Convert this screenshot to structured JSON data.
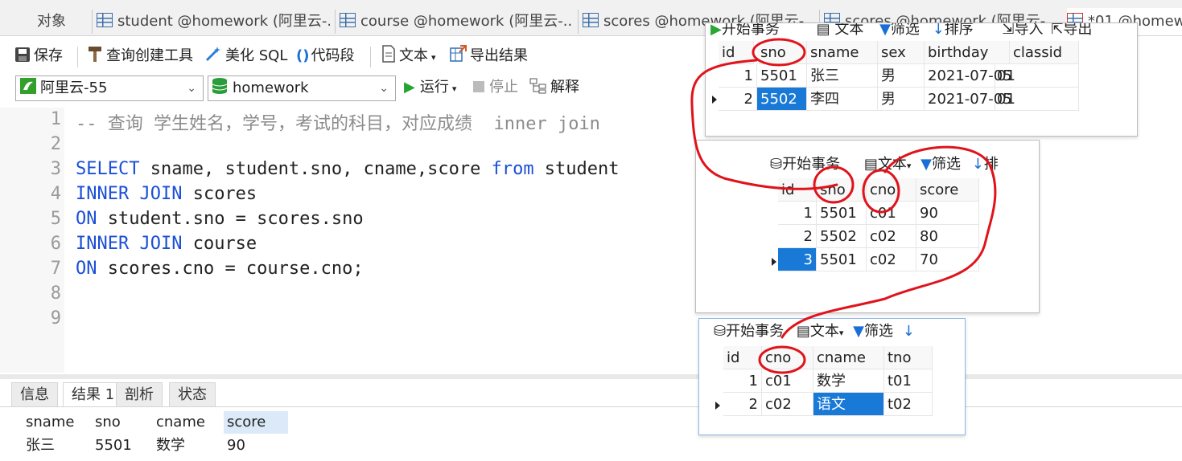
{
  "tabs": [
    {
      "label": "对象"
    },
    {
      "label": "student @homework (阿里云-..."
    },
    {
      "label": "course @homework (阿里云-..."
    },
    {
      "label": "scores @homework (阿里云-"
    },
    {
      "label": "scores @homework (阿里云-"
    },
    {
      "label": "*01 @homew"
    }
  ],
  "toolbar": {
    "save": "保存",
    "query_builder": "查询创建工具",
    "beautify": "美化 SQL",
    "snippet": "代码段",
    "text": "文本",
    "export": "导出结果"
  },
  "connection": {
    "value": "阿里云-55"
  },
  "database": {
    "value": "homework"
  },
  "run": {
    "label": "运行",
    "stop": "停止",
    "explain": "解释"
  },
  "editor": {
    "line_numbers": [
      "1",
      "2",
      "3",
      "4",
      "5",
      "6",
      "7",
      "8",
      "9"
    ],
    "comment": "-- 查询 学生姓名，学号，考试的科目，对应成绩  inner join",
    "l3_kw1": "SELECT",
    "l3_mid": " sname, student.sno, cname,score ",
    "l3_kw2": "from",
    "l3_end": " student",
    "l4_kw": "INNER JOIN",
    "l4_end": " scores",
    "l5_kw": "ON",
    "l5_end": " student.sno = scores.sno",
    "l6_kw": "INNER JOIN",
    "l6_end": " course",
    "l7_kw": "ON",
    "l7_end": " scores.cno = course.cno;"
  },
  "bottom_tabs": [
    "信息",
    "结果 1",
    "剖析",
    "状态"
  ],
  "result": {
    "columns": [
      "sname",
      "sno",
      "cname",
      "score"
    ],
    "rows": [
      [
        "张三",
        "5501",
        "数学",
        "90"
      ]
    ]
  },
  "student_popup": {
    "toolbar": [
      "开始事务",
      "文本",
      "筛选",
      "排序",
      "导入",
      "导出"
    ],
    "columns": [
      "id",
      "sno",
      "sname",
      "sex",
      "birthday",
      "classid"
    ],
    "rows": [
      [
        "1",
        "5501",
        "张三",
        "男",
        "2021-07-05",
        "01"
      ],
      [
        "2",
        "5502",
        "李四",
        "男",
        "2021-07-05",
        "01"
      ]
    ]
  },
  "scores_popup": {
    "toolbar": [
      "开始事务",
      "文本",
      "筛选",
      "排"
    ],
    "columns": [
      "id",
      "sno",
      "cno",
      "score"
    ],
    "rows": [
      [
        "1",
        "5501",
        "c01",
        "90"
      ],
      [
        "2",
        "5502",
        "c02",
        "80"
      ],
      [
        "3",
        "5501",
        "c02",
        "70"
      ]
    ]
  },
  "course_popup": {
    "toolbar": [
      "开始事务",
      "文本",
      "筛选"
    ],
    "columns": [
      "id",
      "cno",
      "cname",
      "tno"
    ],
    "rows": [
      [
        "1",
        "c01",
        "数学",
        "t01"
      ],
      [
        "2",
        "c02",
        "语文",
        "t02"
      ]
    ]
  },
  "colors": {
    "keyword": "#1a4fd6",
    "selection": "#1979d6",
    "annotation": "#e0131b"
  }
}
